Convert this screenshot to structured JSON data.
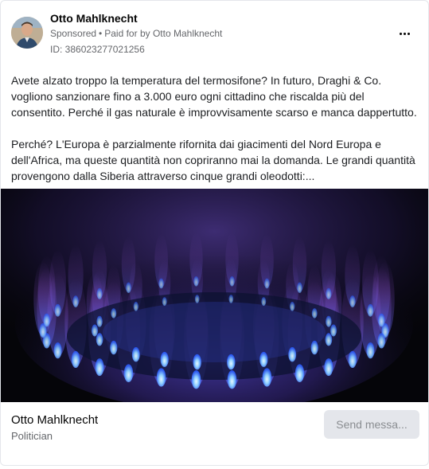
{
  "post": {
    "author_name": "Otto Mahlknecht",
    "sponsored_label": "Sponsored",
    "separator": "•",
    "paid_by_prefix": "Paid for by",
    "paid_by_name": "Otto Mahlknecht",
    "ad_id": "ID: 386023277021256",
    "more_icon": "more-horizontal-icon",
    "paragraphs": [
      "Avete alzato troppo la temperatura del termosifone? In futuro, Draghi & Co. vogliono sanzionare fino a 3.000 euro ogni cittadino che riscalda più del consentito. Perché il gas naturale è improvvisamente scarso e manca dappertutto.",
      "Perché? L'Europa è parzialmente rifornita dai giacimenti del Nord Europa e dell'Africa, ma queste quantità non copriranno mai la domanda. Le grandi quantità provengono dalla Siberia attraverso cinque grandi oleodotti:..."
    ]
  },
  "footer": {
    "page_name": "Otto Mahlknecht",
    "page_category": "Politician",
    "cta_label": "Send messa..."
  },
  "colors": {
    "flame_blue": "#3d6dff",
    "flame_core": "#bfe8ff",
    "flame_purple": "#7a4fd8",
    "background": "#050509"
  }
}
